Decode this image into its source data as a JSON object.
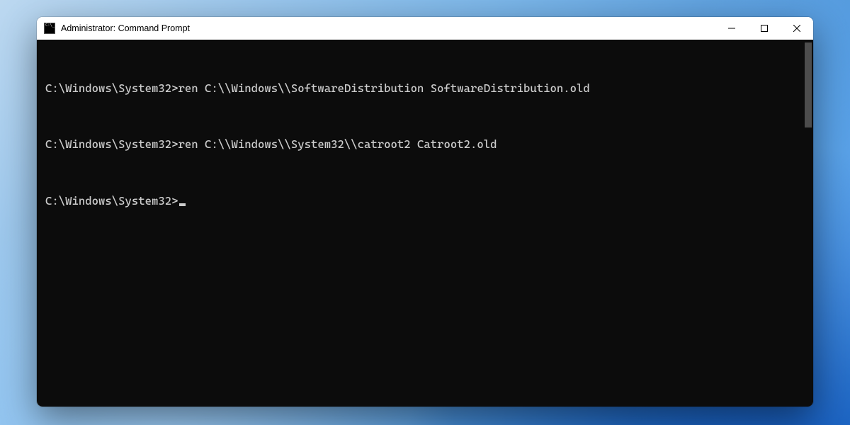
{
  "window": {
    "title": "Administrator: Command Prompt"
  },
  "console": {
    "lines": [
      {
        "prompt": "C:\\Windows\\System32>",
        "command": "ren C:\\\\Windows\\\\SoftwareDistribution SoftwareDistribution.old"
      },
      {
        "prompt": "C:\\Windows\\System32>",
        "command": "ren C:\\\\Windows\\\\System32\\\\catroot2 Catroot2.old"
      },
      {
        "prompt": "C:\\Windows\\System32>",
        "command": ""
      }
    ]
  }
}
